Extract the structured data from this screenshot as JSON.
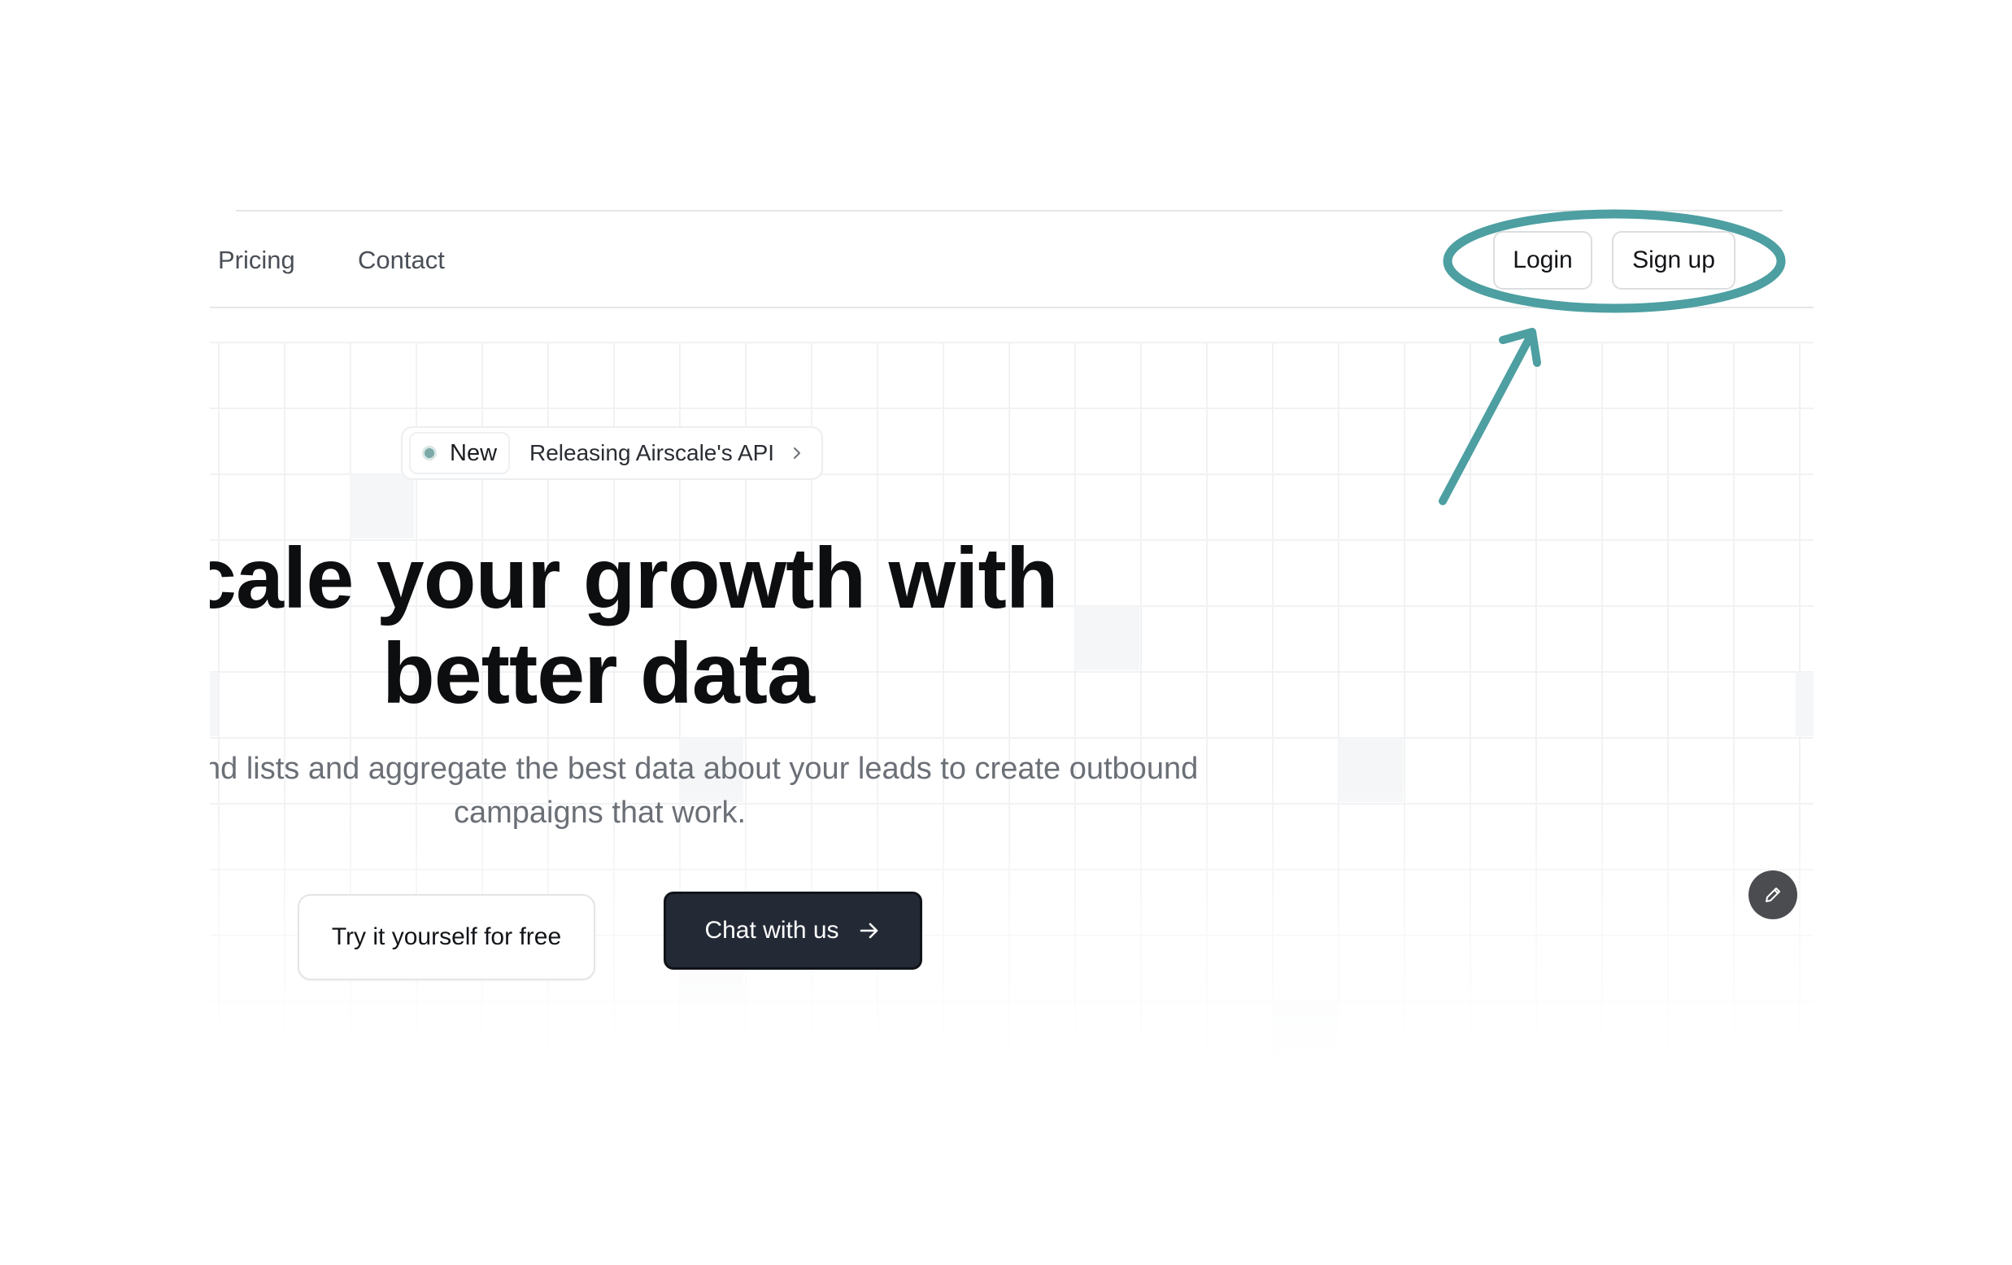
{
  "nav": {
    "links": [
      "Pricing",
      "Contact"
    ],
    "login_label": "Login",
    "signup_label": "Sign up"
  },
  "announcement": {
    "badge_label": "New",
    "text": "Releasing Airscale's API"
  },
  "hero": {
    "headline_line1": "cale your growth with",
    "headline_line2": "better data",
    "subtitle_line1": "nd lists and aggregate the best data about your leads to create outbound",
    "subtitle_line2": "campaigns that work."
  },
  "cta": {
    "try_label": "Try it yourself for free",
    "chat_label": "Chat with us"
  },
  "icons": {
    "announcement_dot": "status-dot-icon",
    "announcement_arrow": "chevron-right-icon",
    "chat_arrow": "arrow-right-icon",
    "edit": "pencil-icon"
  },
  "colors": {
    "annotation": "#4d9fa1",
    "primary_button": "#242a35",
    "dot": "#7aa9a8"
  }
}
